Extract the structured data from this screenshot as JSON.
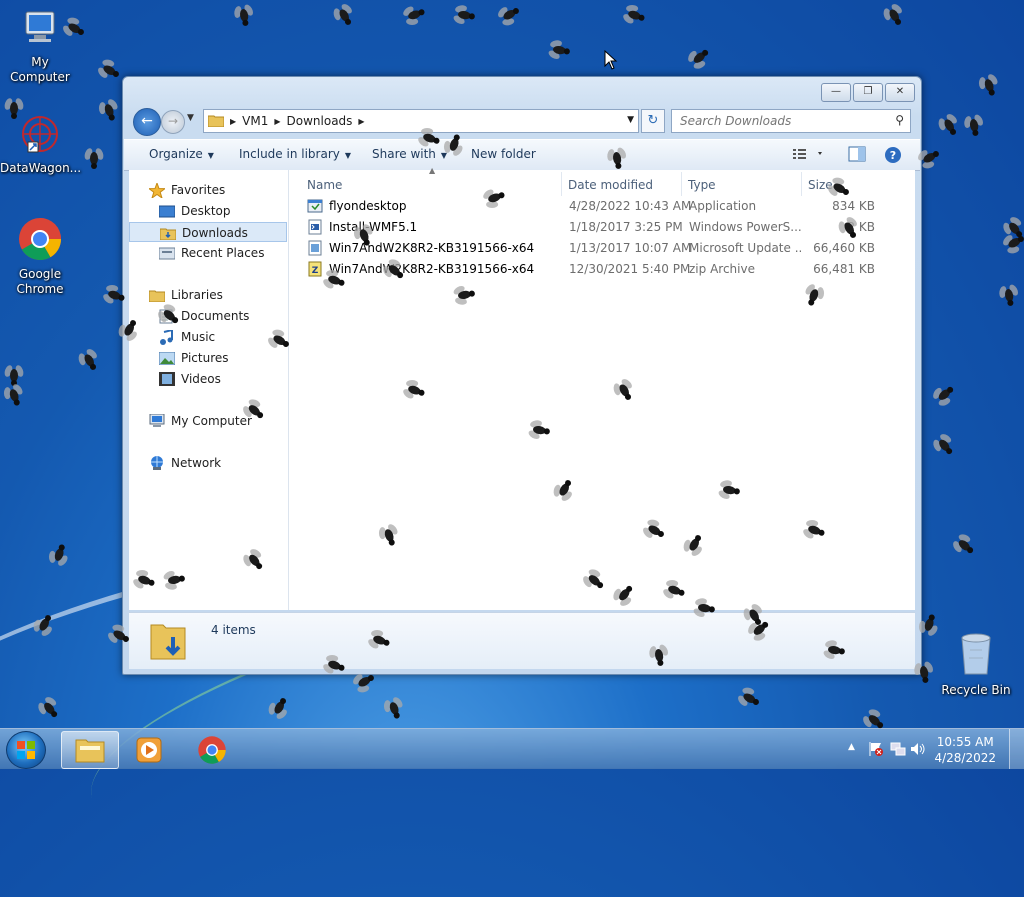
{
  "desktop": {
    "icons": [
      {
        "label": "My Computer"
      },
      {
        "label": "DataWagon..."
      },
      {
        "label": "Google Chrome"
      },
      {
        "label": "Recycle Bin"
      }
    ]
  },
  "window": {
    "caption_buttons": {
      "minimize": "—",
      "maximize": "❐",
      "close": "✕"
    },
    "address": {
      "crumbs": [
        "VM1",
        "Downloads"
      ]
    },
    "search": {
      "placeholder": "Search Downloads"
    },
    "toolbar": {
      "organize": "Organize",
      "include_in_library": "Include in library",
      "share_with": "Share with",
      "new_folder": "New folder"
    },
    "nav": {
      "favorites": "Favorites",
      "desktop": "Desktop",
      "downloads": "Downloads",
      "recent_places": "Recent Places",
      "libraries": "Libraries",
      "documents": "Documents",
      "music": "Music",
      "pictures": "Pictures",
      "videos": "Videos",
      "my_computer": "My Computer",
      "network": "Network"
    },
    "columns": {
      "name": "Name",
      "date": "Date modified",
      "type": "Type",
      "size": "Size"
    },
    "files": [
      {
        "name": "flyondesktop",
        "date": "4/28/2022 10:43 AM",
        "type": "Application",
        "size": "834 KB",
        "icon": "application-icon"
      },
      {
        "name": "Install-WMF5.1",
        "date": "1/18/2017 3:25 PM",
        "type": "Windows PowerS...",
        "size": "2 KB",
        "icon": "powershell-script-icon"
      },
      {
        "name": "Win7AndW2K8R2-KB3191566-x64",
        "date": "1/13/2017 10:07 AM",
        "type": "Microsoft Update ...",
        "size": "66,460 KB",
        "icon": "update-package-icon"
      },
      {
        "name": "Win7AndW2K8R2-KB3191566-x64",
        "date": "12/30/2021 5:40 PM",
        "type": "zip Archive",
        "size": "66,481 KB",
        "icon": "zip-archive-icon"
      }
    ],
    "details": {
      "item_count": "4 items"
    }
  },
  "taskbar": {
    "clock": {
      "time": "10:55 AM",
      "date": "4/28/2022"
    }
  },
  "colors": {
    "accent": "#1459b0",
    "selection": "#dbe9f8",
    "taskbar": "#5b8fc8"
  }
}
